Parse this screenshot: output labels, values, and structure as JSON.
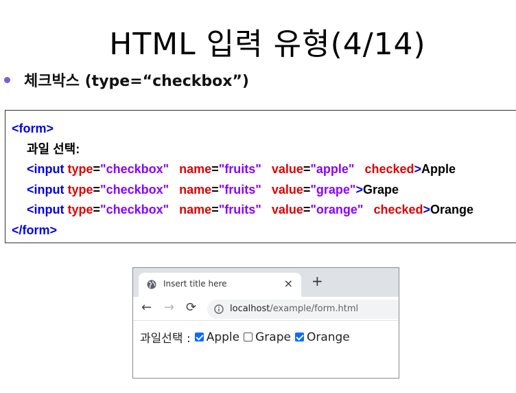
{
  "slide": {
    "title": "HTML 입력 유형(4/14)",
    "bullet": "체크박스 (type=“checkbox”)"
  },
  "code": {
    "form_open": "<form>",
    "form_label": "과일 선택:",
    "lines": [
      {
        "tag": "<input",
        "type_attr": "type",
        "type_val": "\"checkbox\"",
        "name_attr": "name",
        "name_val": "\"fruits\"",
        "value_attr": "value",
        "value_val": "\"apple\"",
        "checked_attr": "checked",
        "close": ">",
        "text": "Apple"
      },
      {
        "tag": "<input",
        "type_attr": "type",
        "type_val": "\"checkbox\"",
        "name_attr": "name",
        "name_val": "\"fruits\"",
        "value_attr": "value",
        "value_val": "\"grape\"",
        "checked_attr": "",
        "close": ">",
        "text": "Grape"
      },
      {
        "tag": "<input",
        "type_attr": "type",
        "type_val": "\"checkbox\"",
        "name_attr": "name",
        "name_val": "\"fruits\"",
        "value_attr": "value",
        "value_val": "\"orange\"",
        "checked_attr": "checked",
        "close": ">",
        "text": "Orange"
      }
    ],
    "form_close": "</form>",
    "eq": "="
  },
  "browser": {
    "tab_title": "Insert title here",
    "tab_close": "×",
    "new_tab": "+",
    "back": "←",
    "forward": "→",
    "reload": "⟳",
    "url_host": "localhost",
    "url_path": "/example/form.html",
    "form_label": "과일선택 :",
    "options": [
      {
        "label": "Apple",
        "checked": true
      },
      {
        "label": "Grape",
        "checked": false
      },
      {
        "label": "Orange",
        "checked": true
      }
    ]
  },
  "colors": {
    "tag": "#0000ee",
    "attribute": "#e00000",
    "value": "#8a00ff",
    "checkbox_checked": "#0b6bff",
    "bullet": "#7b5cd6"
  },
  "icons": {
    "tab_favicon": "globe-icon",
    "address_info": "info-icon"
  }
}
